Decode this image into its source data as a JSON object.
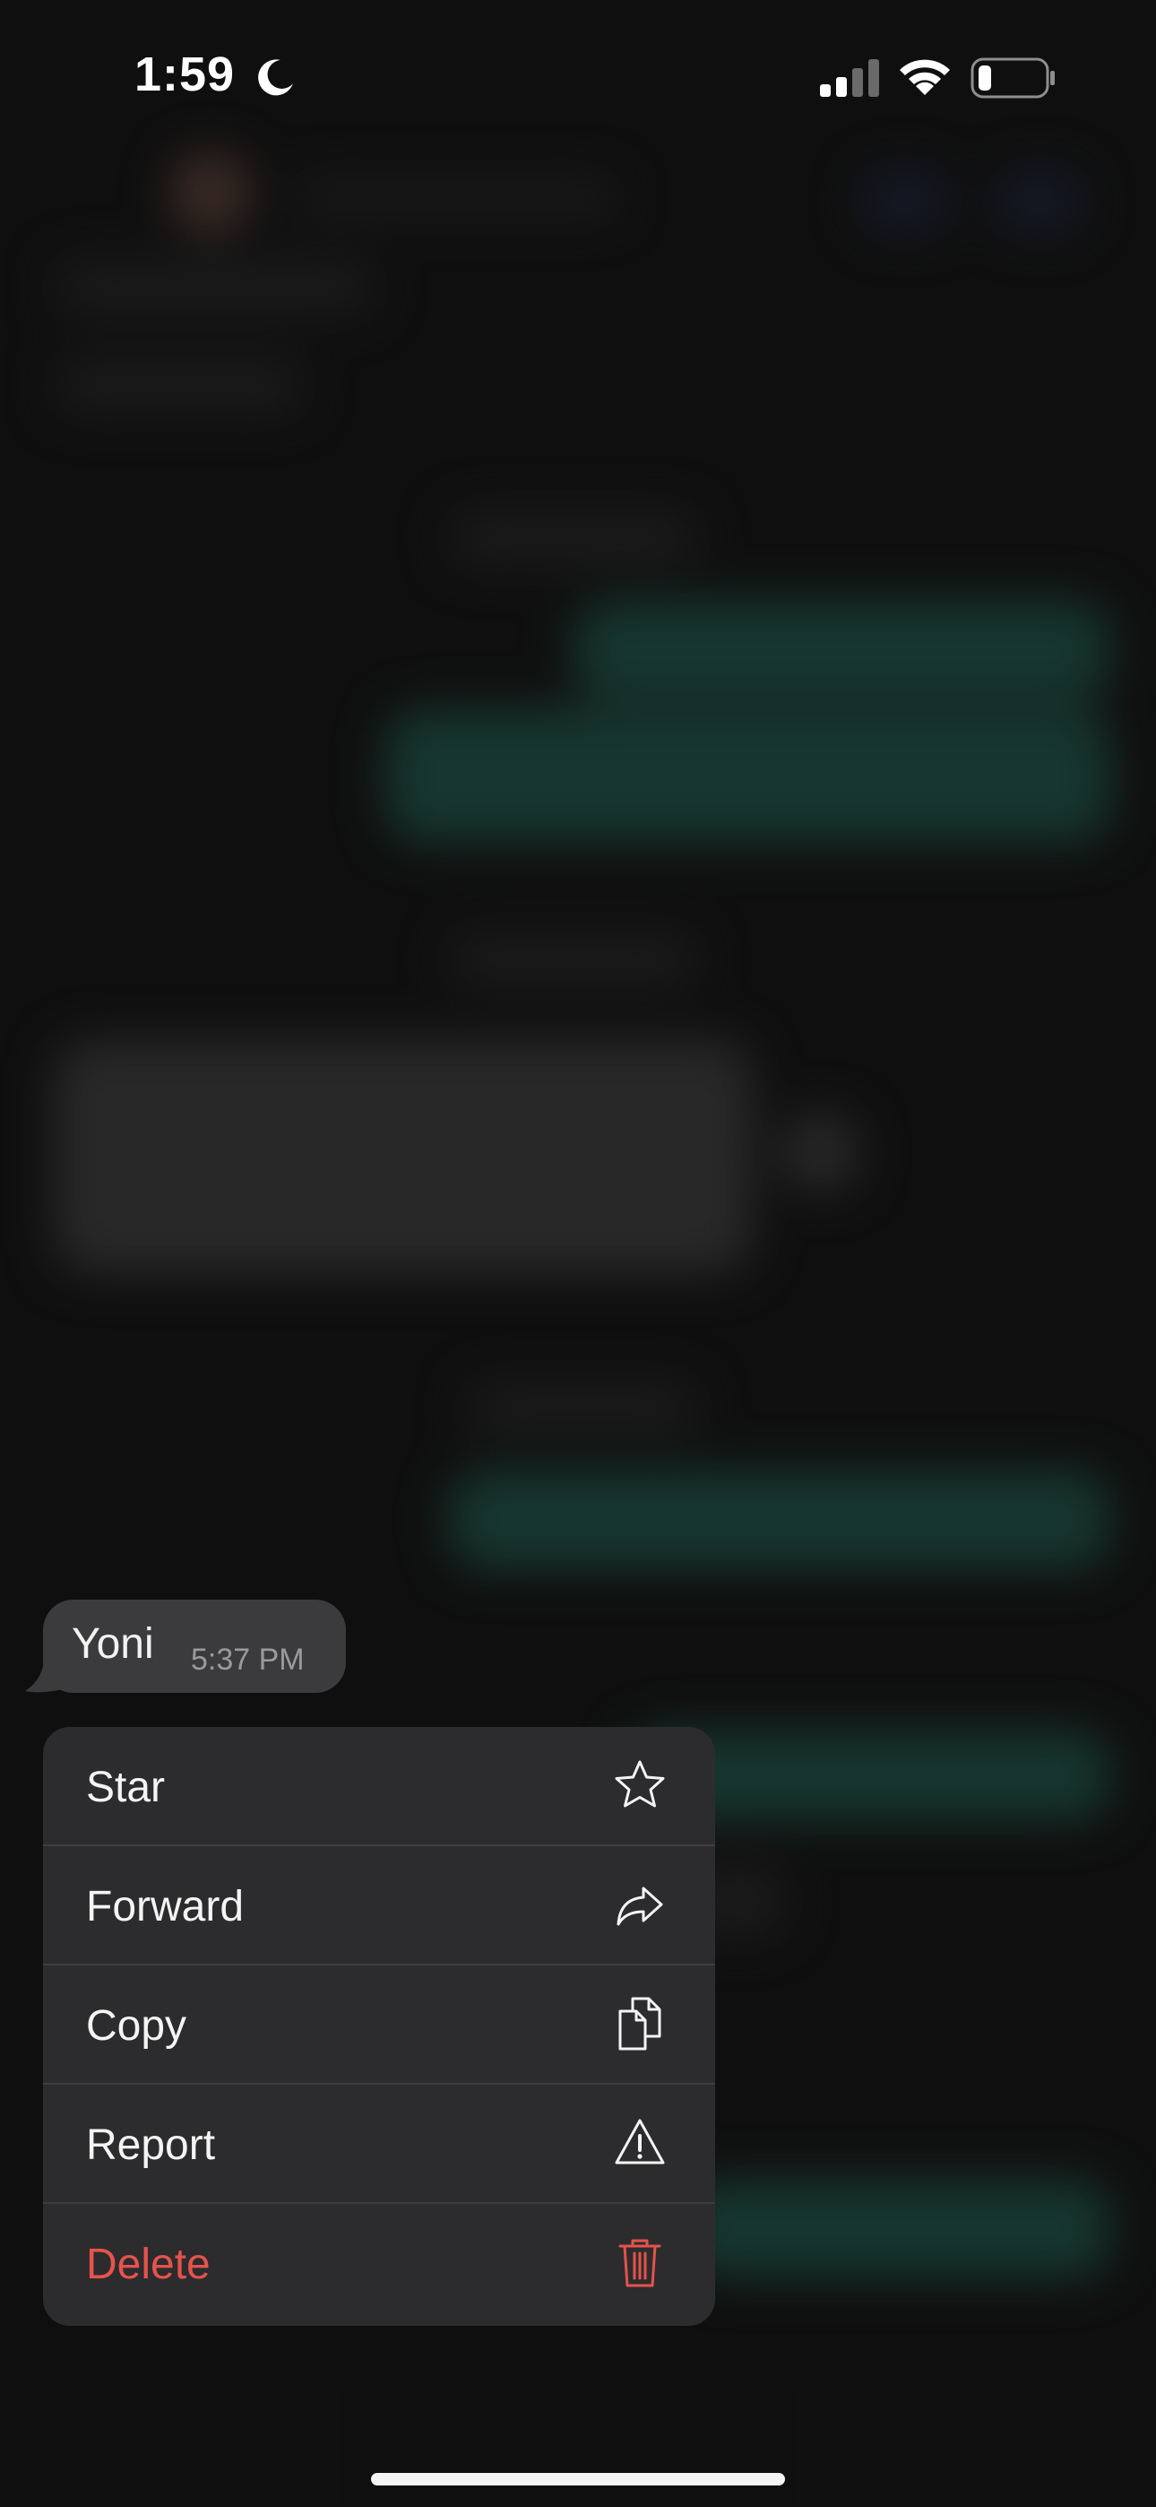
{
  "status_bar": {
    "time": "1:59",
    "icons": [
      "moon-icon",
      "cellular-signal-icon",
      "wifi-icon",
      "battery-icon"
    ]
  },
  "message": {
    "text": "Yoni",
    "time": "5:37 PM"
  },
  "context_menu": {
    "items": [
      {
        "label": "Star",
        "icon": "star-icon"
      },
      {
        "label": "Forward",
        "icon": "forward-icon"
      },
      {
        "label": "Copy",
        "icon": "copy-icon"
      },
      {
        "label": "Report",
        "icon": "warning-icon"
      },
      {
        "label": "Delete",
        "icon": "trash-icon",
        "destructive": true
      }
    ]
  },
  "colors": {
    "background": "#131313",
    "bubble": "#3b3b3d",
    "menu": "#2c2c2e",
    "destructive": "#e5534b",
    "chat_green": "#1f4f44"
  }
}
